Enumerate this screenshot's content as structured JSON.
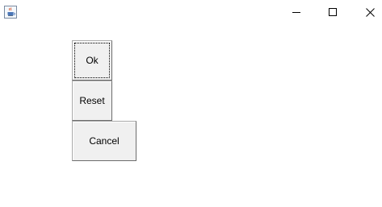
{
  "window": {
    "app_icon": "java-coffee-cup-icon",
    "controls": {
      "minimize_icon": "minimize-icon",
      "maximize_icon": "maximize-icon",
      "close_icon": "close-icon"
    }
  },
  "buttons": {
    "ok_label": "Ok",
    "reset_label": "Reset",
    "cancel_label": "Cancel"
  }
}
